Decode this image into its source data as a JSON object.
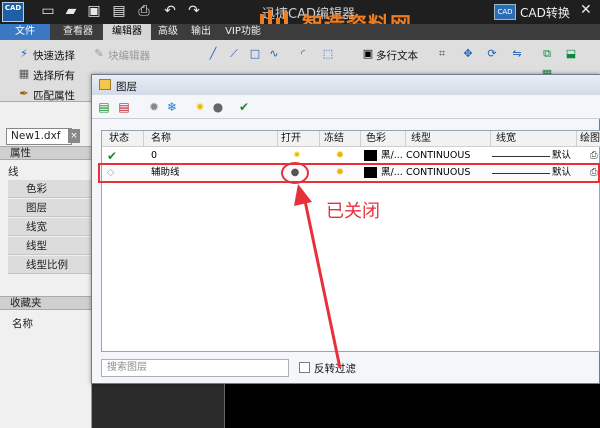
{
  "app": {
    "logo_text": "CAD",
    "title": "迅捷CAD编辑器",
    "convert_icon_text": "CAD",
    "convert_label": "CAD转换",
    "quick_access": [
      "new-icon",
      "open-icon",
      "save-icon",
      "save-as-icon",
      "print-icon",
      "undo-icon",
      "redo-icon"
    ]
  },
  "watermark": {
    "text": "智造资料网"
  },
  "tabs": [
    {
      "label": "文件"
    },
    {
      "label": "查看器"
    },
    {
      "label": "编辑器"
    },
    {
      "label": "高级"
    },
    {
      "label": "输出"
    },
    {
      "label": "VIP功能"
    }
  ],
  "ribbon": {
    "quick_select": "快速选择",
    "block_edit": "块编辑器",
    "select_all": "选择所有",
    "match_props": "匹配属性",
    "multiline_text": "多行文本"
  },
  "left_panel": {
    "doc_tab": "New1.dxf",
    "doc_close": "×",
    "properties_header": "属性",
    "category": "线",
    "props": [
      "色彩",
      "图层",
      "线宽",
      "线型",
      "线型比例"
    ],
    "favorites_header": "收藏夹",
    "name_header": "名称"
  },
  "dialog": {
    "title": "图层",
    "columns": [
      "状态",
      "名称",
      "打开",
      "冻结",
      "色彩",
      "线型",
      "线宽",
      "绘图"
    ],
    "rows": [
      {
        "status": "current",
        "name": "0",
        "on": true,
        "freeze": false,
        "color": "黑/...",
        "linetype": "CONTINUOUS",
        "lineweight": "默认"
      },
      {
        "status": "normal",
        "name": "辅助线",
        "on": false,
        "freeze": false,
        "color": "黑/...",
        "linetype": "CONTINUOUS",
        "lineweight": "默认"
      }
    ],
    "search_placeholder": "搜索图层",
    "invert_filter": "反转过滤"
  },
  "annotation": {
    "text": "已关闭",
    "color": "#e8303a"
  },
  "colors": {
    "accent": "#3a78c3",
    "watermark": "#f07c1e",
    "highlight": "#e8303a"
  }
}
